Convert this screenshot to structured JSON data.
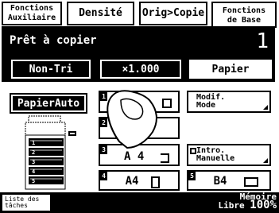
{
  "tabs": [
    {
      "label_line1": "Fonctions",
      "label_line2": "Auxiliaire"
    },
    {
      "label": "Densité"
    },
    {
      "label": "Orig>Copie"
    },
    {
      "label_line1": "Fonctions",
      "label_line2": "de Base"
    }
  ],
  "panel": {
    "status": "Prêt à copier",
    "copy_count": "1",
    "sort_button": "Non-Tri",
    "zoom_button": "×1.000",
    "paper_button": "Papier"
  },
  "paper_auto": "PapierAuto",
  "paper_buttons": [
    {
      "num": "1",
      "label": ""
    },
    {
      "num": "2",
      "label": ""
    },
    {
      "num": "3",
      "label": "A 4"
    },
    {
      "num": "4",
      "label": "A4"
    },
    {
      "num": "5",
      "label": "B4"
    }
  ],
  "modif_mode": {
    "line1": "Modif.",
    "line2": "Mode"
  },
  "intro_manuelle": {
    "line1": "Intro.",
    "line2": "Manuelle"
  },
  "tray_numbers": [
    "1",
    "2",
    "3",
    "4",
    "5"
  ],
  "bottom": {
    "jobs_line1": "Liste des",
    "jobs_line2": "tâches",
    "memory_line1": "Mémoire",
    "memory_line2": "Libre",
    "memory_pct": "100%"
  }
}
